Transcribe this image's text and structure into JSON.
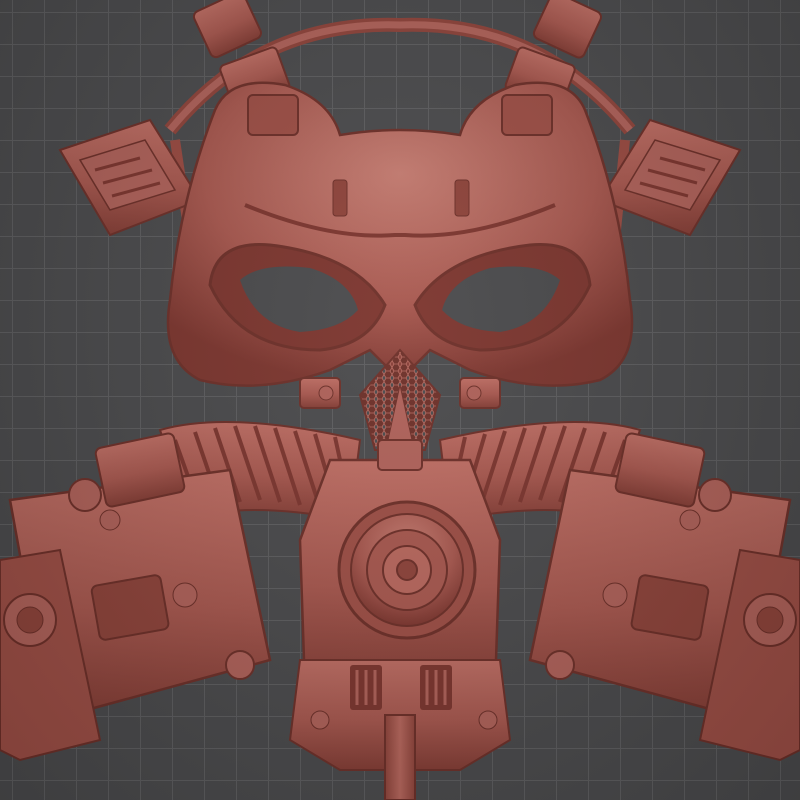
{
  "viewport": {
    "grid_color": "#5e5e60",
    "background_color": "#4b4b4d"
  },
  "model": {
    "subject": "gas-mask-skull-sculpt",
    "material_color": "#a8584f",
    "highlight_color": "#c97a70",
    "shadow_color": "#6e3029"
  }
}
